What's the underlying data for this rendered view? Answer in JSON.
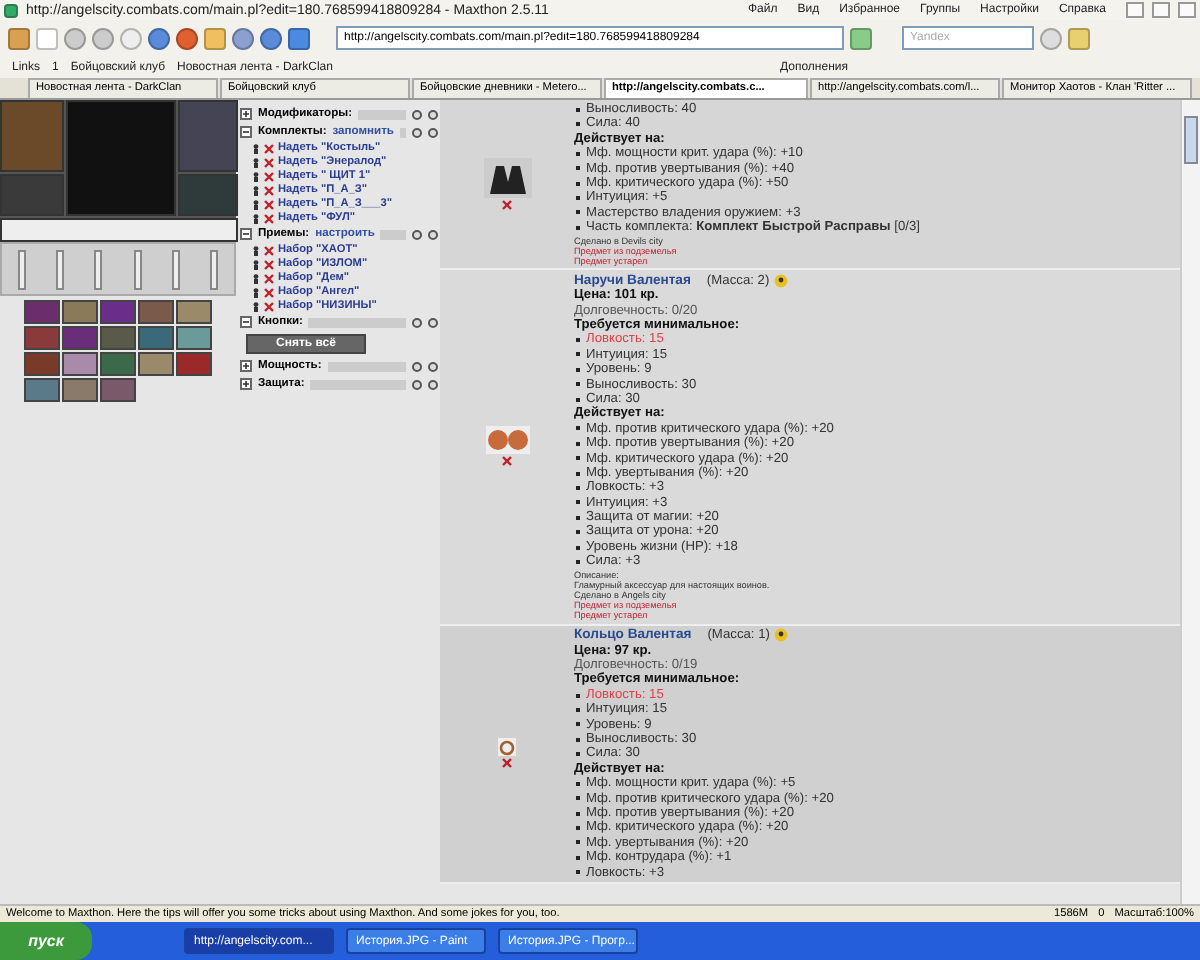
{
  "window": {
    "title": "http://angelscity.combats.com/main.pl?edit=180.768599418809284 - Maxthon 2.5.11",
    "menu": [
      "Файл",
      "Вид",
      "Избранное",
      "Группы",
      "Настройки",
      "Справка"
    ]
  },
  "toolbar": {
    "address": {
      "value": "http://angelscity.combats.com/main.pl?edit=180.768599418809284"
    },
    "search": {
      "placeholder": "Yandex"
    }
  },
  "links_bar": {
    "items": [
      "Links",
      "1",
      "Бойцовский клуб",
      "Новостная лента - DarkClan"
    ],
    "addons": "Дополнения"
  },
  "tabs": [
    {
      "label": "Новостная лента - DarkClan",
      "selected": false
    },
    {
      "label": "Бойцовский клуб",
      "selected": false
    },
    {
      "label": "Бойцовские дневники - Metero...",
      "selected": false
    },
    {
      "label": "http://angelscity.combats.c...",
      "selected": true
    },
    {
      "label": "http://angelscity.combats.com/l...",
      "selected": false
    },
    {
      "label": "Монитор Хаотов - Клан 'Ritter ...",
      "selected": false
    }
  ],
  "sections": [
    {
      "title": "Модификаторы:",
      "expanded": false
    },
    {
      "title": "Комплекты:",
      "expanded": true,
      "action": "запомнить",
      "entries": [
        "Надеть \"Костыль\"",
        "Надеть \"Энералод\"",
        "Надеть \" ЩИТ 1\"",
        "Надеть \"П_А_З\"",
        "Надеть \"П_А_З___3\"",
        "Надеть \"ФУЛ\""
      ]
    },
    {
      "title": "Приемы:",
      "expanded": true,
      "action": "настроить",
      "entries": [
        "Набор \"ХАОТ\"",
        "Набор \"ИЗЛОМ\"",
        "Набор \"Дем\"",
        "Набор \"Ангел\"",
        "Набор \"НИЗИНЫ\""
      ]
    },
    {
      "title": "Кнопки:",
      "expanded": true,
      "button": "Снять всё"
    },
    {
      "title": "Мощность:",
      "expanded": false
    },
    {
      "title": "Защита:",
      "expanded": false
    }
  ],
  "items": [
    {
      "lines": [
        {
          "kind": "requirement",
          "text": "Выносливость: 40",
          "met": true
        },
        {
          "kind": "requirement",
          "text": "Сила: 40",
          "met": true
        },
        {
          "kind": "heading",
          "text": "Действует на:"
        },
        {
          "kind": "effect",
          "text": "Мф. мощности крит. удара (%): +10"
        },
        {
          "kind": "effect",
          "text": "Мф. против увертывания (%): +40"
        },
        {
          "kind": "effect",
          "text": "Мф. критического удара (%): +50"
        },
        {
          "kind": "effect",
          "text": "Интуиция: +5"
        },
        {
          "kind": "effect",
          "text": "Мастерство владения оружием: +3"
        },
        {
          "kind": "effect",
          "text": "Часть комплекта: **Комплект Быстрой Расправы** [0/3]"
        },
        {
          "kind": "note",
          "text": "Сделано в Devils city"
        },
        {
          "kind": "warning",
          "text": "Предмет из подземелья"
        },
        {
          "kind": "warning",
          "text": "Предмет устарел"
        }
      ]
    },
    {
      "name": "Наручи Валентая",
      "mass": "(Масса: 2)",
      "lines": [
        {
          "kind": "price",
          "text": "Цена: 101 кр."
        },
        {
          "kind": "durability",
          "text": "Долговечность: 0/20"
        },
        {
          "kind": "heading",
          "text": "Требуется минимальное:"
        },
        {
          "kind": "requirement",
          "text": "Ловкость: 15",
          "met": false
        },
        {
          "kind": "requirement",
          "text": "Интуиция: 15",
          "met": true
        },
        {
          "kind": "requirement",
          "text": "Уровень: 9",
          "met": true
        },
        {
          "kind": "requirement",
          "text": "Выносливость: 30",
          "met": true
        },
        {
          "kind": "requirement",
          "text": "Сила: 30",
          "met": true
        },
        {
          "kind": "heading",
          "text": "Действует на:"
        },
        {
          "kind": "effect",
          "text": "Мф. против критического удара (%): +20"
        },
        {
          "kind": "effect",
          "text": "Мф. против увертывания (%): +20"
        },
        {
          "kind": "effect",
          "text": "Мф. критического удара (%): +20"
        },
        {
          "kind": "effect",
          "text": "Мф. увертывания (%): +20"
        },
        {
          "kind": "effect",
          "text": "Ловкость: +3"
        },
        {
          "kind": "effect",
          "text": "Интуиция: +3"
        },
        {
          "kind": "effect",
          "text": "Защита от магии: +20"
        },
        {
          "kind": "effect",
          "text": "Защита от урона: +20"
        },
        {
          "kind": "effect",
          "text": "Уровень жизни (HP): +18"
        },
        {
          "kind": "effect",
          "text": "Сила: +3"
        },
        {
          "kind": "note",
          "text": "Описание:"
        },
        {
          "kind": "note",
          "text": "Гламурный аксессуар для настоящих воинов."
        },
        {
          "kind": "note",
          "text": "Сделано в Angels city"
        },
        {
          "kind": "warning",
          "text": "Предмет из подземелья"
        },
        {
          "kind": "warning",
          "text": "Предмет устарел"
        }
      ]
    },
    {
      "name": "Кольцо Валентая",
      "mass": "(Масса: 1)",
      "lines": [
        {
          "kind": "price",
          "text": "Цена: 97 кр."
        },
        {
          "kind": "durability",
          "text": "Долговечность: 0/19"
        },
        {
          "kind": "heading",
          "text": "Требуется минимальное:"
        },
        {
          "kind": "requirement",
          "text": "Ловкость: 15",
          "met": false
        },
        {
          "kind": "requirement",
          "text": "Интуиция: 15",
          "met": true
        },
        {
          "kind": "requirement",
          "text": "Уровень: 9",
          "met": true
        },
        {
          "kind": "requirement",
          "text": "Выносливость: 30",
          "met": true
        },
        {
          "kind": "requirement",
          "text": "Сила: 30",
          "met": true
        },
        {
          "kind": "heading",
          "text": "Действует на:"
        },
        {
          "kind": "effect",
          "text": "Мф. мощности крит. удара (%): +5"
        },
        {
          "kind": "effect",
          "text": "Мф. против критического удара (%): +20"
        },
        {
          "kind": "effect",
          "text": "Мф. против увертывания (%): +20"
        },
        {
          "kind": "effect",
          "text": "Мф. критического удара (%): +20"
        },
        {
          "kind": "effect",
          "text": "Мф. увертывания (%): +20"
        },
        {
          "kind": "effect",
          "text": "Мф. контрудара (%): +1"
        },
        {
          "kind": "effect",
          "text": "Ловкость: +3"
        }
      ]
    }
  ],
  "status_bar": {
    "text": "Welcome to Maxthon. Here the tips will offer you some tricks about using Maxthon. And some jokes for you, too.",
    "memory": "1586M",
    "count": "0",
    "zoom": "Масштаб:100%"
  },
  "taskbar": {
    "start": "пуск",
    "tasks": [
      {
        "label": "http://angelscity.com...",
        "selected": true
      },
      {
        "label": "История.JPG - Paint",
        "selected": false
      },
      {
        "label": "История.JPG - Прогр...",
        "selected": false
      }
    ]
  }
}
